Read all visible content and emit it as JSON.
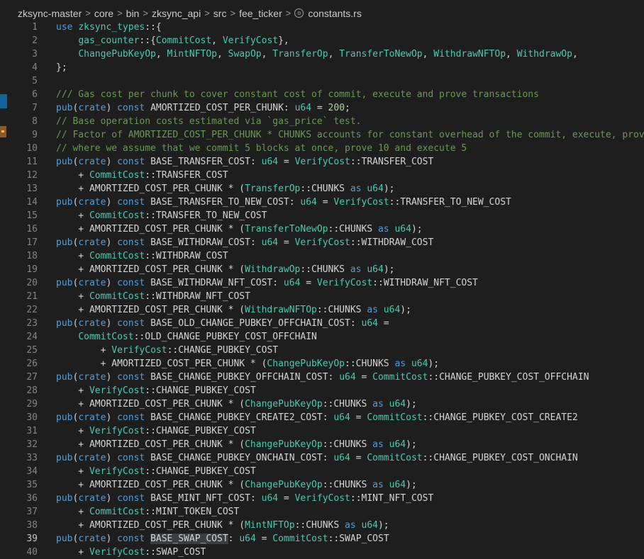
{
  "breadcrumb": {
    "segments": [
      "zksync-master",
      "core",
      "bin",
      "zksync_api",
      "src",
      "fee_ticker"
    ],
    "file": "constants.rs",
    "separator": ">",
    "file_icon": "rust-file-icon"
  },
  "editor": {
    "active_line": 39,
    "highlighted_token": "BASE_SWAP_COST",
    "lines": [
      {
        "n": "1",
        "tokens": [
          [
            "kw",
            "use"
          ],
          [
            "p",
            " "
          ],
          [
            "ty",
            "zksync_types"
          ],
          [
            "p",
            "::{"
          ]
        ]
      },
      {
        "n": "2",
        "tokens": [
          [
            "p",
            "    "
          ],
          [
            "ty",
            "gas_counter"
          ],
          [
            "p",
            "::{"
          ],
          [
            "ty",
            "CommitCost"
          ],
          [
            "p",
            ", "
          ],
          [
            "ty",
            "VerifyCost"
          ],
          [
            "p",
            "},"
          ]
        ]
      },
      {
        "n": "3",
        "tokens": [
          [
            "p",
            "    "
          ],
          [
            "ty",
            "ChangePubKeyOp"
          ],
          [
            "p",
            ", "
          ],
          [
            "ty",
            "MintNFTOp"
          ],
          [
            "p",
            ", "
          ],
          [
            "ty",
            "SwapOp"
          ],
          [
            "p",
            ", "
          ],
          [
            "ty",
            "TransferOp"
          ],
          [
            "p",
            ", "
          ],
          [
            "ty",
            "TransferToNewOp"
          ],
          [
            "p",
            ", "
          ],
          [
            "ty",
            "WithdrawNFTOp"
          ],
          [
            "p",
            ", "
          ],
          [
            "ty",
            "WithdrawOp"
          ],
          [
            "p",
            ","
          ]
        ]
      },
      {
        "n": "4",
        "tokens": [
          [
            "p",
            "};"
          ]
        ]
      },
      {
        "n": "5",
        "tokens": []
      },
      {
        "n": "6",
        "tokens": [
          [
            "cm",
            "/// Gas cost per chunk to cover constant cost of commit, execute and prove transactions"
          ]
        ]
      },
      {
        "n": "7",
        "tokens": [
          [
            "kw",
            "pub"
          ],
          [
            "p",
            "("
          ],
          [
            "kw",
            "crate"
          ],
          [
            "p",
            ") "
          ],
          [
            "kw",
            "const"
          ],
          [
            "p",
            " AMORTIZED_COST_PER_CHUNK: "
          ],
          [
            "ty",
            "u64"
          ],
          [
            "p",
            " = "
          ],
          [
            "num",
            "200"
          ],
          [
            "p",
            ";"
          ]
        ]
      },
      {
        "n": "8",
        "tokens": [
          [
            "cm",
            "// Base operation costs estimated via `gas_price` test."
          ]
        ]
      },
      {
        "n": "9",
        "tokens": [
          [
            "cm",
            "// Factor of AMORTIZED_COST_PER_CHUNK * CHUNKS accounts for constant overhead of the commit, execute, prove"
          ]
        ]
      },
      {
        "n": "10",
        "tokens": [
          [
            "cm",
            "// where we assume that we commit 5 blocks at once, prove 10 and execute 5"
          ]
        ]
      },
      {
        "n": "11",
        "tokens": [
          [
            "kw",
            "pub"
          ],
          [
            "p",
            "("
          ],
          [
            "kw",
            "crate"
          ],
          [
            "p",
            ") "
          ],
          [
            "kw",
            "const"
          ],
          [
            "p",
            " BASE_TRANSFER_COST: "
          ],
          [
            "ty",
            "u64"
          ],
          [
            "p",
            " = "
          ],
          [
            "ty",
            "VerifyCost"
          ],
          [
            "p",
            "::TRANSFER_COST"
          ]
        ]
      },
      {
        "n": "12",
        "tokens": [
          [
            "p",
            "    + "
          ],
          [
            "ty",
            "CommitCost"
          ],
          [
            "p",
            "::TRANSFER_COST"
          ]
        ]
      },
      {
        "n": "13",
        "tokens": [
          [
            "p",
            "    + AMORTIZED_COST_PER_CHUNK * ("
          ],
          [
            "ty",
            "TransferOp"
          ],
          [
            "p",
            "::CHUNKS "
          ],
          [
            "kw",
            "as"
          ],
          [
            "p",
            " "
          ],
          [
            "ty",
            "u64"
          ],
          [
            "p",
            ");"
          ]
        ]
      },
      {
        "n": "14",
        "tokens": [
          [
            "kw",
            "pub"
          ],
          [
            "p",
            "("
          ],
          [
            "kw",
            "crate"
          ],
          [
            "p",
            ") "
          ],
          [
            "kw",
            "const"
          ],
          [
            "p",
            " BASE_TRANSFER_TO_NEW_COST: "
          ],
          [
            "ty",
            "u64"
          ],
          [
            "p",
            " = "
          ],
          [
            "ty",
            "VerifyCost"
          ],
          [
            "p",
            "::TRANSFER_TO_NEW_COST"
          ]
        ]
      },
      {
        "n": "15",
        "tokens": [
          [
            "p",
            "    + "
          ],
          [
            "ty",
            "CommitCost"
          ],
          [
            "p",
            "::TRANSFER_TO_NEW_COST"
          ]
        ]
      },
      {
        "n": "16",
        "tokens": [
          [
            "p",
            "    + AMORTIZED_COST_PER_CHUNK * ("
          ],
          [
            "ty",
            "TransferToNewOp"
          ],
          [
            "p",
            "::CHUNKS "
          ],
          [
            "kw",
            "as"
          ],
          [
            "p",
            " "
          ],
          [
            "ty",
            "u64"
          ],
          [
            "p",
            ");"
          ]
        ]
      },
      {
        "n": "17",
        "tokens": [
          [
            "kw",
            "pub"
          ],
          [
            "p",
            "("
          ],
          [
            "kw",
            "crate"
          ],
          [
            "p",
            ") "
          ],
          [
            "kw",
            "const"
          ],
          [
            "p",
            " BASE_WITHDRAW_COST: "
          ],
          [
            "ty",
            "u64"
          ],
          [
            "p",
            " = "
          ],
          [
            "ty",
            "VerifyCost"
          ],
          [
            "p",
            "::WITHDRAW_COST"
          ]
        ]
      },
      {
        "n": "18",
        "tokens": [
          [
            "p",
            "    + "
          ],
          [
            "ty",
            "CommitCost"
          ],
          [
            "p",
            "::WITHDRAW_COST"
          ]
        ]
      },
      {
        "n": "19",
        "tokens": [
          [
            "p",
            "    + AMORTIZED_COST_PER_CHUNK * ("
          ],
          [
            "ty",
            "WithdrawOp"
          ],
          [
            "p",
            "::CHUNKS "
          ],
          [
            "kw",
            "as"
          ],
          [
            "p",
            " "
          ],
          [
            "ty",
            "u64"
          ],
          [
            "p",
            ");"
          ]
        ]
      },
      {
        "n": "20",
        "tokens": [
          [
            "kw",
            "pub"
          ],
          [
            "p",
            "("
          ],
          [
            "kw",
            "crate"
          ],
          [
            "p",
            ") "
          ],
          [
            "kw",
            "const"
          ],
          [
            "p",
            " BASE_WITHDRAW_NFT_COST: "
          ],
          [
            "ty",
            "u64"
          ],
          [
            "p",
            " = "
          ],
          [
            "ty",
            "VerifyCost"
          ],
          [
            "p",
            "::WITHDRAW_NFT_COST"
          ]
        ]
      },
      {
        "n": "21",
        "tokens": [
          [
            "p",
            "    + "
          ],
          [
            "ty",
            "CommitCost"
          ],
          [
            "p",
            "::WITHDRAW_NFT_COST"
          ]
        ]
      },
      {
        "n": "22",
        "tokens": [
          [
            "p",
            "    + AMORTIZED_COST_PER_CHUNK * ("
          ],
          [
            "ty",
            "WithdrawNFTOp"
          ],
          [
            "p",
            "::CHUNKS "
          ],
          [
            "kw",
            "as"
          ],
          [
            "p",
            " "
          ],
          [
            "ty",
            "u64"
          ],
          [
            "p",
            ");"
          ]
        ]
      },
      {
        "n": "23",
        "tokens": [
          [
            "kw",
            "pub"
          ],
          [
            "p",
            "("
          ],
          [
            "kw",
            "crate"
          ],
          [
            "p",
            ") "
          ],
          [
            "kw",
            "const"
          ],
          [
            "p",
            " BASE_OLD_CHANGE_PUBKEY_OFFCHAIN_COST: "
          ],
          [
            "ty",
            "u64"
          ],
          [
            "p",
            " ="
          ]
        ]
      },
      {
        "n": "24",
        "tokens": [
          [
            "p",
            "    "
          ],
          [
            "ty",
            "CommitCost"
          ],
          [
            "p",
            "::OLD_CHANGE_PUBKEY_COST_OFFCHAIN"
          ]
        ]
      },
      {
        "n": "25",
        "tokens": [
          [
            "p",
            "        + "
          ],
          [
            "ty",
            "VerifyCost"
          ],
          [
            "p",
            "::CHANGE_PUBKEY_COST"
          ]
        ]
      },
      {
        "n": "26",
        "tokens": [
          [
            "p",
            "        + AMORTIZED_COST_PER_CHUNK * ("
          ],
          [
            "ty",
            "ChangePubKeyOp"
          ],
          [
            "p",
            "::CHUNKS "
          ],
          [
            "kw",
            "as"
          ],
          [
            "p",
            " "
          ],
          [
            "ty",
            "u64"
          ],
          [
            "p",
            ");"
          ]
        ]
      },
      {
        "n": "27",
        "tokens": [
          [
            "kw",
            "pub"
          ],
          [
            "p",
            "("
          ],
          [
            "kw",
            "crate"
          ],
          [
            "p",
            ") "
          ],
          [
            "kw",
            "const"
          ],
          [
            "p",
            " BASE_CHANGE_PUBKEY_OFFCHAIN_COST: "
          ],
          [
            "ty",
            "u64"
          ],
          [
            "p",
            " = "
          ],
          [
            "ty",
            "CommitCost"
          ],
          [
            "p",
            "::CHANGE_PUBKEY_COST_OFFCHAIN"
          ]
        ]
      },
      {
        "n": "28",
        "tokens": [
          [
            "p",
            "    + "
          ],
          [
            "ty",
            "VerifyCost"
          ],
          [
            "p",
            "::CHANGE_PUBKEY_COST"
          ]
        ]
      },
      {
        "n": "29",
        "tokens": [
          [
            "p",
            "    + AMORTIZED_COST_PER_CHUNK * ("
          ],
          [
            "ty",
            "ChangePubKeyOp"
          ],
          [
            "p",
            "::CHUNKS "
          ],
          [
            "kw",
            "as"
          ],
          [
            "p",
            " "
          ],
          [
            "ty",
            "u64"
          ],
          [
            "p",
            ");"
          ]
        ]
      },
      {
        "n": "30",
        "tokens": [
          [
            "kw",
            "pub"
          ],
          [
            "p",
            "("
          ],
          [
            "kw",
            "crate"
          ],
          [
            "p",
            ") "
          ],
          [
            "kw",
            "const"
          ],
          [
            "p",
            " BASE_CHANGE_PUBKEY_CREATE2_COST: "
          ],
          [
            "ty",
            "u64"
          ],
          [
            "p",
            " = "
          ],
          [
            "ty",
            "CommitCost"
          ],
          [
            "p",
            "::CHANGE_PUBKEY_COST_CREATE2"
          ]
        ]
      },
      {
        "n": "31",
        "tokens": [
          [
            "p",
            "    + "
          ],
          [
            "ty",
            "VerifyCost"
          ],
          [
            "p",
            "::CHANGE_PUBKEY_COST"
          ]
        ]
      },
      {
        "n": "32",
        "tokens": [
          [
            "p",
            "    + AMORTIZED_COST_PER_CHUNK * ("
          ],
          [
            "ty",
            "ChangePubKeyOp"
          ],
          [
            "p",
            "::CHUNKS "
          ],
          [
            "kw",
            "as"
          ],
          [
            "p",
            " "
          ],
          [
            "ty",
            "u64"
          ],
          [
            "p",
            ");"
          ]
        ]
      },
      {
        "n": "33",
        "tokens": [
          [
            "kw",
            "pub"
          ],
          [
            "p",
            "("
          ],
          [
            "kw",
            "crate"
          ],
          [
            "p",
            ") "
          ],
          [
            "kw",
            "const"
          ],
          [
            "p",
            " BASE_CHANGE_PUBKEY_ONCHAIN_COST: "
          ],
          [
            "ty",
            "u64"
          ],
          [
            "p",
            " = "
          ],
          [
            "ty",
            "CommitCost"
          ],
          [
            "p",
            "::CHANGE_PUBKEY_COST_ONCHAIN"
          ]
        ]
      },
      {
        "n": "34",
        "tokens": [
          [
            "p",
            "    + "
          ],
          [
            "ty",
            "VerifyCost"
          ],
          [
            "p",
            "::CHANGE_PUBKEY_COST"
          ]
        ]
      },
      {
        "n": "35",
        "tokens": [
          [
            "p",
            "    + AMORTIZED_COST_PER_CHUNK * ("
          ],
          [
            "ty",
            "ChangePubKeyOp"
          ],
          [
            "p",
            "::CHUNKS "
          ],
          [
            "kw",
            "as"
          ],
          [
            "p",
            " "
          ],
          [
            "ty",
            "u64"
          ],
          [
            "p",
            ");"
          ]
        ]
      },
      {
        "n": "36",
        "tokens": [
          [
            "kw",
            "pub"
          ],
          [
            "p",
            "("
          ],
          [
            "kw",
            "crate"
          ],
          [
            "p",
            ") "
          ],
          [
            "kw",
            "const"
          ],
          [
            "p",
            " BASE_MINT_NFT_COST: "
          ],
          [
            "ty",
            "u64"
          ],
          [
            "p",
            " = "
          ],
          [
            "ty",
            "VerifyCost"
          ],
          [
            "p",
            "::MINT_NFT_COST"
          ]
        ]
      },
      {
        "n": "37",
        "tokens": [
          [
            "p",
            "    + "
          ],
          [
            "ty",
            "CommitCost"
          ],
          [
            "p",
            "::MINT_TOKEN_COST"
          ]
        ]
      },
      {
        "n": "38",
        "tokens": [
          [
            "p",
            "    + AMORTIZED_COST_PER_CHUNK * ("
          ],
          [
            "ty",
            "MintNFTOp"
          ],
          [
            "p",
            "::CHUNKS "
          ],
          [
            "kw",
            "as"
          ],
          [
            "p",
            " "
          ],
          [
            "ty",
            "u64"
          ],
          [
            "p",
            ");"
          ]
        ]
      },
      {
        "n": "39",
        "tokens": [
          [
            "kw",
            "pub"
          ],
          [
            "p",
            "("
          ],
          [
            "kw",
            "crate"
          ],
          [
            "p",
            ") "
          ],
          [
            "kw",
            "const"
          ],
          [
            "p",
            " "
          ],
          [
            "hl",
            "BASE_SWAP_COST"
          ],
          [
            "p",
            ": "
          ],
          [
            "ty",
            "u64"
          ],
          [
            "p",
            " = "
          ],
          [
            "ty",
            "CommitCost"
          ],
          [
            "p",
            "::SWAP_COST"
          ]
        ]
      },
      {
        "n": "40",
        "tokens": [
          [
            "p",
            "    + "
          ],
          [
            "ty",
            "VerifyCost"
          ],
          [
            "p",
            "::SWAP_COST"
          ]
        ]
      }
    ]
  }
}
